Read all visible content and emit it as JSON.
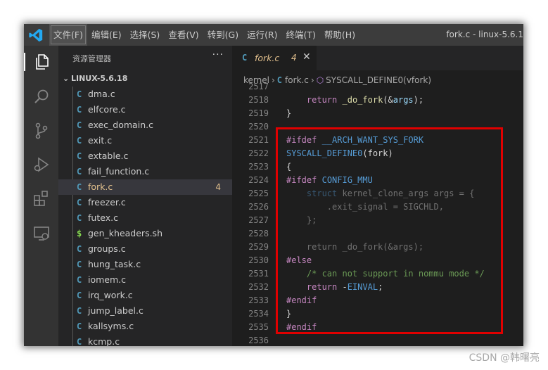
{
  "titlebar": {
    "menu": [
      "文件(F)",
      "编辑(E)",
      "选择(S)",
      "查看(V)",
      "转到(G)",
      "运行(R)",
      "终端(T)",
      "帮助(H)"
    ],
    "title": "fork.c - linux-5.6.1"
  },
  "activity_bar": {
    "items": [
      "explorer-icon",
      "search-icon",
      "source-control-icon",
      "run-debug-icon",
      "extensions-icon",
      "remote-explorer-icon"
    ]
  },
  "sidebar": {
    "header": "资源管理器",
    "more": "···",
    "folder": "LINUX-5.6.18",
    "files": [
      {
        "icon": "C",
        "name": "dma.c"
      },
      {
        "icon": "C",
        "name": "elfcore.c"
      },
      {
        "icon": "C",
        "name": "exec_domain.c"
      },
      {
        "icon": "C",
        "name": "exit.c"
      },
      {
        "icon": "C",
        "name": "extable.c"
      },
      {
        "icon": "C",
        "name": "fail_function.c"
      },
      {
        "icon": "C",
        "name": "fork.c",
        "badge": "4"
      },
      {
        "icon": "C",
        "name": "freezer.c"
      },
      {
        "icon": "C",
        "name": "futex.c"
      },
      {
        "icon": "$",
        "name": "gen_kheaders.sh"
      },
      {
        "icon": "C",
        "name": "groups.c"
      },
      {
        "icon": "C",
        "name": "hung_task.c"
      },
      {
        "icon": "C",
        "name": "iomem.c"
      },
      {
        "icon": "C",
        "name": "irq_work.c"
      },
      {
        "icon": "C",
        "name": "jump_label.c"
      },
      {
        "icon": "C",
        "name": "kallsyms.c"
      },
      {
        "icon": "C",
        "name": "kcmp.c"
      }
    ]
  },
  "editor": {
    "tab": {
      "icon": "C",
      "name": "fork.c",
      "badge": "4",
      "close": "✕"
    },
    "breadcrumb": {
      "folder": "kernel",
      "file": "fork.c",
      "symbol": "SYSCALL_DEFINE0(vfork)"
    },
    "lines": [
      {
        "n": "2517",
        "dim": true,
        "t": []
      },
      {
        "n": "2518",
        "t": [
          [
            "",
            "    "
          ],
          [
            "kw",
            "return"
          ],
          [
            "",
            " "
          ],
          [
            "fn",
            "_do_fork"
          ],
          [
            "",
            "(&"
          ],
          [
            "vr",
            "args"
          ],
          [
            "",
            ");"
          ]
        ]
      },
      {
        "n": "2519",
        "t": [
          [
            "",
            "}"
          ]
        ]
      },
      {
        "n": "2520",
        "t": []
      },
      {
        "n": "2521",
        "t": [
          [
            "pp",
            "#ifdef"
          ],
          [
            "",
            " "
          ],
          [
            "mac",
            "__ARCH_WANT_SYS_FORK"
          ]
        ]
      },
      {
        "n": "2522",
        "t": [
          [
            "mac",
            "SYSCALL_DEFINE0"
          ],
          [
            "",
            "(fork)"
          ]
        ]
      },
      {
        "n": "2523",
        "t": [
          [
            "",
            "{"
          ]
        ]
      },
      {
        "n": "2524",
        "t": [
          [
            "pp",
            "#ifdef"
          ],
          [
            "",
            " "
          ],
          [
            "mac",
            "CONFIG_MMU"
          ]
        ]
      },
      {
        "n": "2525",
        "dim": true,
        "t": [
          [
            "",
            "    "
          ],
          [
            "tp",
            "struct"
          ],
          [
            "",
            " kernel_clone_args args = {"
          ]
        ]
      },
      {
        "n": "2526",
        "dim": true,
        "t": [
          [
            "",
            "        .exit_signal = SIGCHLD,"
          ]
        ]
      },
      {
        "n": "2527",
        "dim": true,
        "t": [
          [
            "",
            "    };"
          ]
        ]
      },
      {
        "n": "2528",
        "t": []
      },
      {
        "n": "2529",
        "dim": true,
        "t": [
          [
            "",
            "    return _do_fork(&args);"
          ]
        ]
      },
      {
        "n": "2530",
        "t": [
          [
            "pp",
            "#else"
          ]
        ]
      },
      {
        "n": "2531",
        "t": [
          [
            "",
            "    "
          ],
          [
            "cm",
            "/* can not support in nommu mode */"
          ]
        ]
      },
      {
        "n": "2532",
        "t": [
          [
            "",
            "    "
          ],
          [
            "kw",
            "return"
          ],
          [
            "",
            " -"
          ],
          [
            "mac",
            "EINVAL"
          ],
          [
            "",
            ";"
          ]
        ]
      },
      {
        "n": "2533",
        "t": [
          [
            "pp",
            "#endif"
          ]
        ]
      },
      {
        "n": "2534",
        "t": [
          [
            "",
            "}"
          ]
        ]
      },
      {
        "n": "2535",
        "t": [
          [
            "pp",
            "#endif"
          ]
        ]
      },
      {
        "n": "2536",
        "t": []
      }
    ]
  },
  "watermark": "CSDN @韩曙亮",
  "colors": {
    "highlight_border": "#e00000",
    "accent": "#007acc",
    "modified": "#e2c08d"
  }
}
